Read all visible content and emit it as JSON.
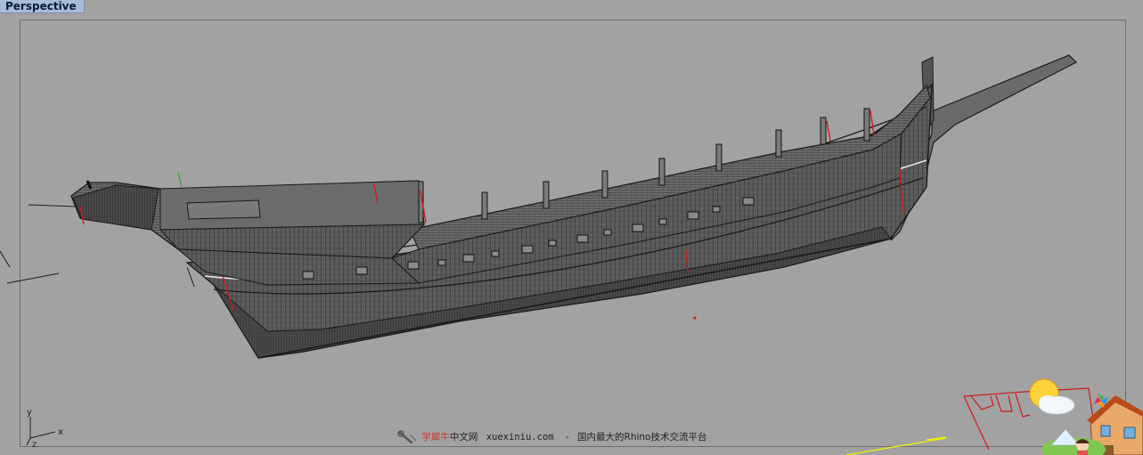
{
  "viewport": {
    "tab_label": "Perspective",
    "axes": {
      "x": "x",
      "y": "y",
      "z": "z"
    }
  },
  "scene": {
    "object": "ship-hull-wireframe",
    "mesh_color": "#2b2b2b",
    "hull_fill": "#5c5c5c",
    "highlight_color": "#d11a1a",
    "selection_color": "#f5f500"
  },
  "watermark": {
    "brand_red": "学犀牛",
    "brand_black": "中文网",
    "url": "xuexiniu.com",
    "dash": "-",
    "slogan": "国内最大的Rhino技术交流平台"
  },
  "overlay_icons": [
    "sun-cloud-icon",
    "house-icon",
    "cartoon-figure-icon",
    "pinwheel-icon"
  ]
}
